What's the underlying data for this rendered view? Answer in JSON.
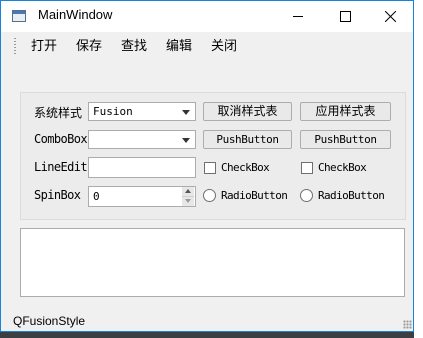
{
  "window": {
    "title": "MainWindow",
    "controls": {
      "minimize": "minimize",
      "maximize": "maximize",
      "close": "close"
    }
  },
  "menubar": {
    "items": [
      {
        "label": "打开"
      },
      {
        "label": "保存"
      },
      {
        "label": "查找"
      },
      {
        "label": "编辑"
      },
      {
        "label": "关闭"
      }
    ]
  },
  "form": {
    "style_label": "系统样式",
    "style_combo_value": "Fusion",
    "cancel_style_button": "取消样式表",
    "apply_style_button": "应用样式表",
    "combobox_label": "ComboBox",
    "combobox_value": "",
    "pushbutton_1": "PushButton",
    "pushbutton_2": "PushButton",
    "lineedit_label": "LineEdit",
    "lineedit_value": "",
    "checkbox_1": "CheckBox",
    "checkbox_2": "CheckBox",
    "spinbox_label": "SpinBox",
    "spinbox_value": "0",
    "radio_1": "RadioButton",
    "radio_2": "RadioButton"
  },
  "statusbar": {
    "text": "QFusionStyle"
  },
  "colors": {
    "accent_border": "#1883d7",
    "window_bg": "#f0f0f0"
  }
}
